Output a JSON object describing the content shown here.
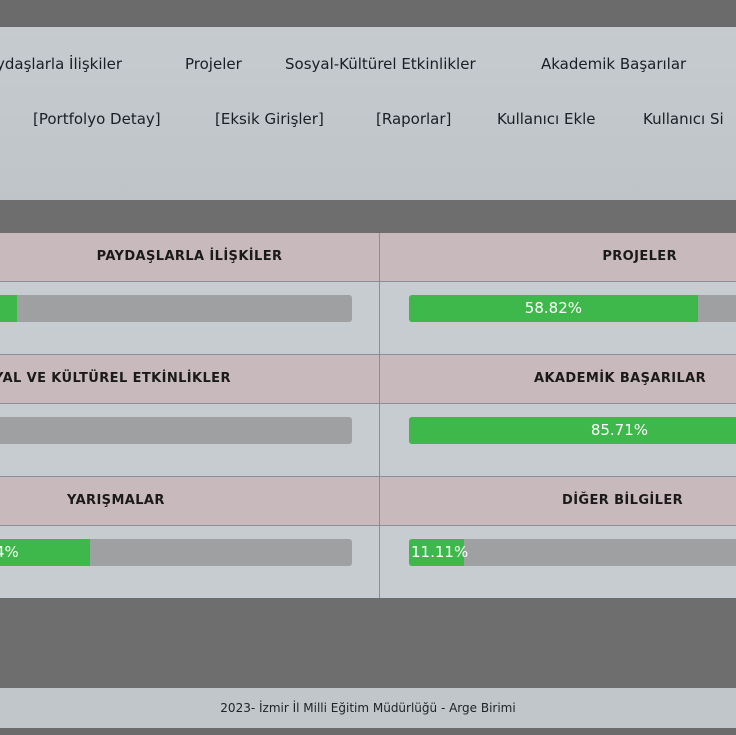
{
  "nav": {
    "row1": [
      "ydaşlarla İlişkiler",
      "Projeler",
      "Sosyal-Kültürel Etkinlikler",
      "Akademik Başarılar"
    ],
    "row2": [
      "[Portfolyo Detay]",
      "[Eksik Girişler]",
      "[Raporlar]",
      "Kullanıcı Ekle",
      "Kullanıcı Si"
    ]
  },
  "cards": [
    {
      "title": "PAYDAŞLARLA İLİŞKİLER",
      "progress_label": "",
      "progress_percent": 7.3
    },
    {
      "title": "PROJELER",
      "progress_label": "58.82%",
      "progress_percent": 58.82
    },
    {
      "title": "YAL VE KÜLTÜREL ETKİNLİKLER",
      "progress_label": "",
      "progress_percent": 0.3
    },
    {
      "title": "AKADEMİK BAŞARILAR",
      "progress_label": "85.71%",
      "progress_percent": 85.71
    },
    {
      "title": "YARIŞMALAR",
      "progress_label": "4%",
      "progress_percent": 27.4
    },
    {
      "title": "DİĞER BİLGİLER",
      "progress_label": "11.11%",
      "progress_percent": 11.11
    }
  ],
  "footer": {
    "text": "2023- İzmir İl Milli Eğitim Müdürlüğü - Arge Birimi"
  },
  "colors": {
    "progress_fill": "#3eb84a",
    "progress_track": "#9fa0a2",
    "card_header_bg": "#c7b9bc",
    "page_band": "#6e6e6e"
  }
}
